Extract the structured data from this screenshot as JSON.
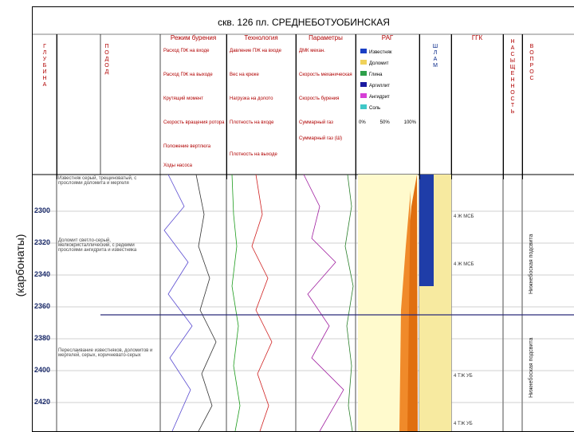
{
  "side_label": "(карбонаты)",
  "title": "скв. 126   пл. СРЕДНЕБОТУОБИНСКАЯ",
  "column_headers": {
    "strat": "Г Л У Б И Н А",
    "sampling": "П О Д О Д",
    "drilling": "Режим бурения",
    "gas": "Технология",
    "params": "Параметры",
    "ggk": "РАГ",
    "lith": "Ш Л А М",
    "description": "ГГК",
    "right1": "Н А С Ы Щ Е Н Н О С Т Ь",
    "right2": "В О П Р О С"
  },
  "drilling_legend": [
    {
      "label": "Расход ПЖ на входе",
      "scale": "0 ... 100,0"
    },
    {
      "label": "Расход ПЖ на выходе",
      "scale": "0 ... 100,0"
    },
    {
      "label": "Крутящий момент",
      "scale": "0 ... 20,0"
    },
    {
      "label": "Скорость вращения ротора",
      "scale": "0 ... 120,0"
    },
    {
      "label": "Положение вертлюга",
      "scale": "0 ... 20,0"
    },
    {
      "label": "Ходы насоса",
      "scale": "0 ... 200,0"
    }
  ],
  "gas_legend": [
    {
      "label": "Давление ПЖ на входе",
      "scale": "0 ... 200,0"
    },
    {
      "label": "Вес на крюке",
      "scale": "0 ... 100,0"
    },
    {
      "label": "Нагрузка на долото",
      "scale": "0 ... 40,0"
    },
    {
      "label": "Плотность на входе",
      "scale": "0 ... 2,0"
    },
    {
      "label": "Плотность на выходе",
      "scale": "1,1 ... 1,3"
    }
  ],
  "params_legend": [
    {
      "label": "ДМК механ.",
      "scale": "0 ... 40,0"
    },
    {
      "label": "Скорость механическая",
      "scale": "0 ... 10,0"
    },
    {
      "label": "Скорость бурения",
      "scale": "0 ... 10,0"
    },
    {
      "label": "Суммарный газ",
      "scale": "0 ... 40,0"
    },
    {
      "label": "Суммарный газ (Ш)",
      "scale": "0 ... 40,0"
    }
  ],
  "gas_types": [
    {
      "name": "Известняк",
      "color": "#1a3fc4"
    },
    {
      "name": "Доломит",
      "color": "#f0d25a"
    },
    {
      "name": "Глина",
      "color": "#2e9f4a"
    },
    {
      "name": "Аргиллит",
      "color": "#1a1aa0"
    },
    {
      "name": "Ангидрит",
      "color": "#d63fd6"
    },
    {
      "name": "Соль",
      "color": "#40c8c8"
    }
  ],
  "gas_scale": [
    "0%",
    "50%",
    "100%"
  ],
  "depths": [
    "2300",
    "2320",
    "2340",
    "2360",
    "2380",
    "2400",
    "2420"
  ],
  "descriptions": [
    "Известняк серый, трещиноватый, с прослоями доломита и мергеля",
    "Доломит светло-серый, мелкокристаллический, с редкими прослоями ангидрита и известняка",
    "Переслаивание известняков, доломитов и мергелей, серых, коричневато-серых"
  ],
  "right_labels": [
    "Нижнебоская подсвита",
    "Нижнебоская подсвита"
  ],
  "lith_codes": [
    "4  Ж  МСБ",
    "4  Ж  МСБ",
    "4  ТЖ  УБ",
    "4  ТЖ  УБ"
  ]
}
